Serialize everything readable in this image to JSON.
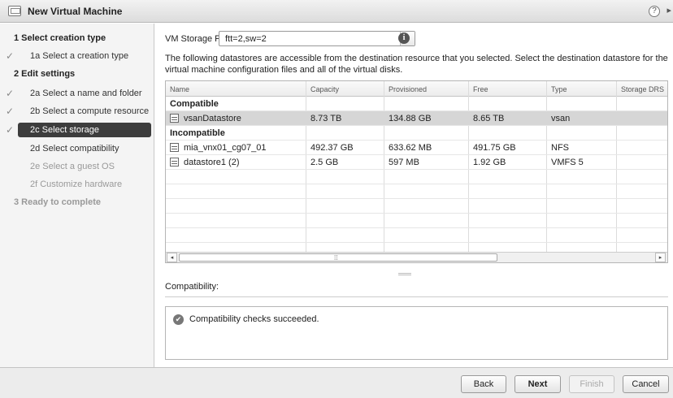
{
  "window": {
    "title": "New Virtual Machine",
    "help_glyph": "?",
    "expand_glyph": "▸"
  },
  "nav": {
    "items": [
      {
        "label": "1  Select creation type",
        "kind": "section",
        "checked": false
      },
      {
        "label": "1a  Select a creation type",
        "kind": "sub",
        "checked": true
      },
      {
        "label": "2  Edit settings",
        "kind": "section",
        "checked": false
      },
      {
        "label": "2a  Select a name and folder",
        "kind": "sub",
        "checked": true
      },
      {
        "label": "2b  Select a compute resource",
        "kind": "sub",
        "checked": true
      },
      {
        "label": "2c  Select storage",
        "kind": "sub",
        "checked": true,
        "active": true
      },
      {
        "label": "2d  Select compatibility",
        "kind": "sub",
        "checked": false
      },
      {
        "label": "2e  Select a guest OS",
        "kind": "sub",
        "disabled": true
      },
      {
        "label": "2f  Customize hardware",
        "kind": "sub",
        "disabled": true
      },
      {
        "label": "3  Ready to complete",
        "kind": "section",
        "disabled": true
      }
    ],
    "check_glyph": "✓"
  },
  "policy": {
    "label": "VM Storage Policy:",
    "value": "ftt=2,sw=2",
    "dropdown_glyph": "▾",
    "info_glyph": "i"
  },
  "description": "The following datastores are accessible from the destination resource that you selected. Select the destination datastore for the virtual machine configuration files and all of the virtual disks.",
  "table": {
    "columns": [
      "Name",
      "Capacity",
      "Provisioned",
      "Free",
      "Type",
      "Storage DRS"
    ],
    "groups": [
      {
        "label": "Compatible",
        "rows": [
          {
            "name": "vsanDatastore",
            "capacity": "8.73 TB",
            "provisioned": "134.88 GB",
            "free": "8.65 TB",
            "type": "vsan",
            "drs": "",
            "selected": true
          }
        ]
      },
      {
        "label": "Incompatible",
        "rows": [
          {
            "name": "mia_vnx01_cg07_01",
            "capacity": "492.37 GB",
            "provisioned": "633.62 MB",
            "free": "491.75 GB",
            "type": "NFS",
            "drs": ""
          },
          {
            "name": "datastore1 (2)",
            "capacity": "2.5 GB",
            "provisioned": "597 MB",
            "free": "1.92 GB",
            "type": "VMFS 5",
            "drs": ""
          }
        ]
      }
    ],
    "scroll_left": "◂",
    "scroll_right": "▸",
    "scroll_grip": "⁞⁞"
  },
  "compatibility": {
    "label": "Compatibility:",
    "message": "Compatibility checks succeeded.",
    "ok_glyph": "✔"
  },
  "footer": {
    "back": "Back",
    "next": "Next",
    "finish": "Finish",
    "cancel": "Cancel"
  }
}
